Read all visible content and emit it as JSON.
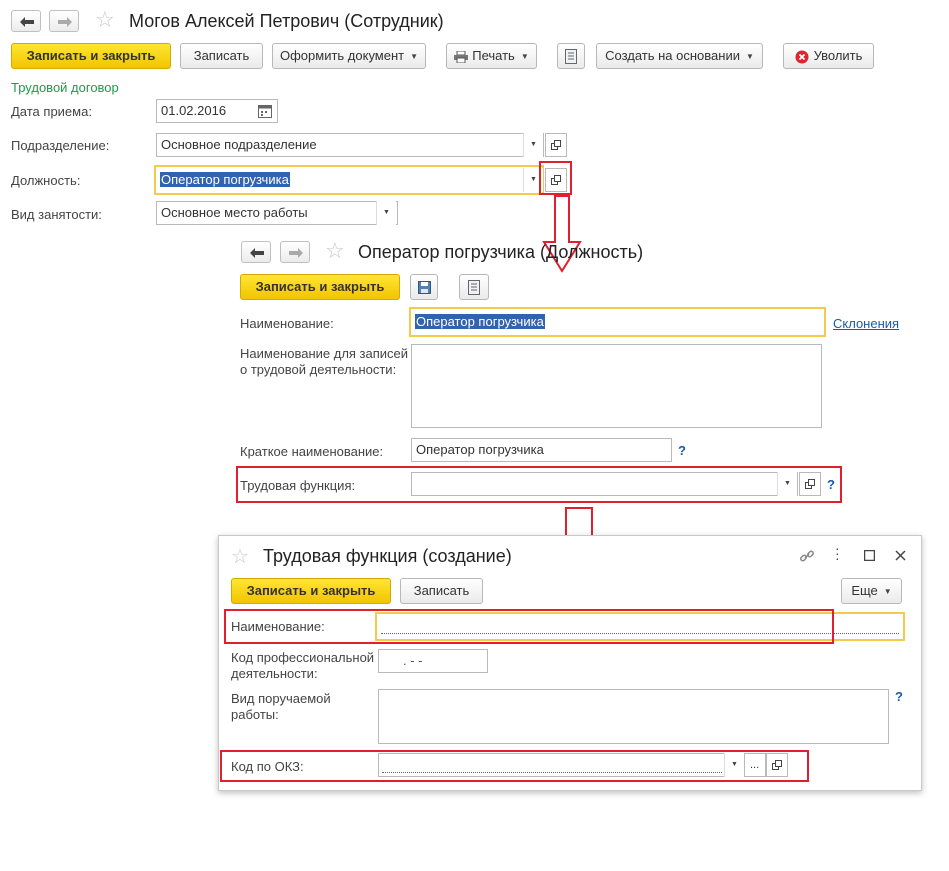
{
  "main": {
    "title": "Могов Алексей Петрович (Сотрудник)",
    "toolbar": {
      "save_close": "Записать и закрыть",
      "save": "Записать",
      "make_document": "Оформить документ",
      "print": "Печать",
      "create_based_on": "Создать на основании",
      "dismiss": "Уволить"
    },
    "section_link": "Трудовой договор",
    "hire_date_label": "Дата приема:",
    "hire_date_value": "01.02.2016",
    "department_label": "Подразделение:",
    "department_value": "Основное подразделение",
    "position_label": "Должность:",
    "position_value": "Оператор погрузчика",
    "employment_type_label": "Вид занятости:",
    "employment_type_value": "Основное место работы"
  },
  "position_form": {
    "title": "Оператор погрузчика (Должность)",
    "save_close": "Записать и закрыть",
    "name_label": "Наименование:",
    "name_value": "Оператор погрузчика",
    "declension_link": "Склонения",
    "work_records_label_line1": "Наименование для записей",
    "work_records_label_line2": "о трудовой деятельности:",
    "short_name_label": "Краткое наименование:",
    "short_name_value": "Оператор погрузчика",
    "labor_function_label": "Трудовая функция:",
    "help": "?"
  },
  "labor_function_form": {
    "title": "Трудовая функция (создание)",
    "save_close": "Записать и закрыть",
    "save": "Записать",
    "more": "Еще",
    "name_label": "Наименование:",
    "prof_code_label_line1": "Код профессиональной",
    "prof_code_label_line2": "деятельности:",
    "prof_code_mask": ". - -",
    "work_kind_label_line1": "Вид поручаемой",
    "work_kind_label_line2": "работы:",
    "okz_label": "Код по ОКЗ:",
    "ellipsis": "...",
    "help": "?"
  },
  "colors": {
    "accent_yellow": "#f2c400",
    "highlight_red": "#e0202e",
    "selection_blue": "#3363b0",
    "link_blue": "#1a5aa6",
    "section_green": "#1e9b4a"
  }
}
